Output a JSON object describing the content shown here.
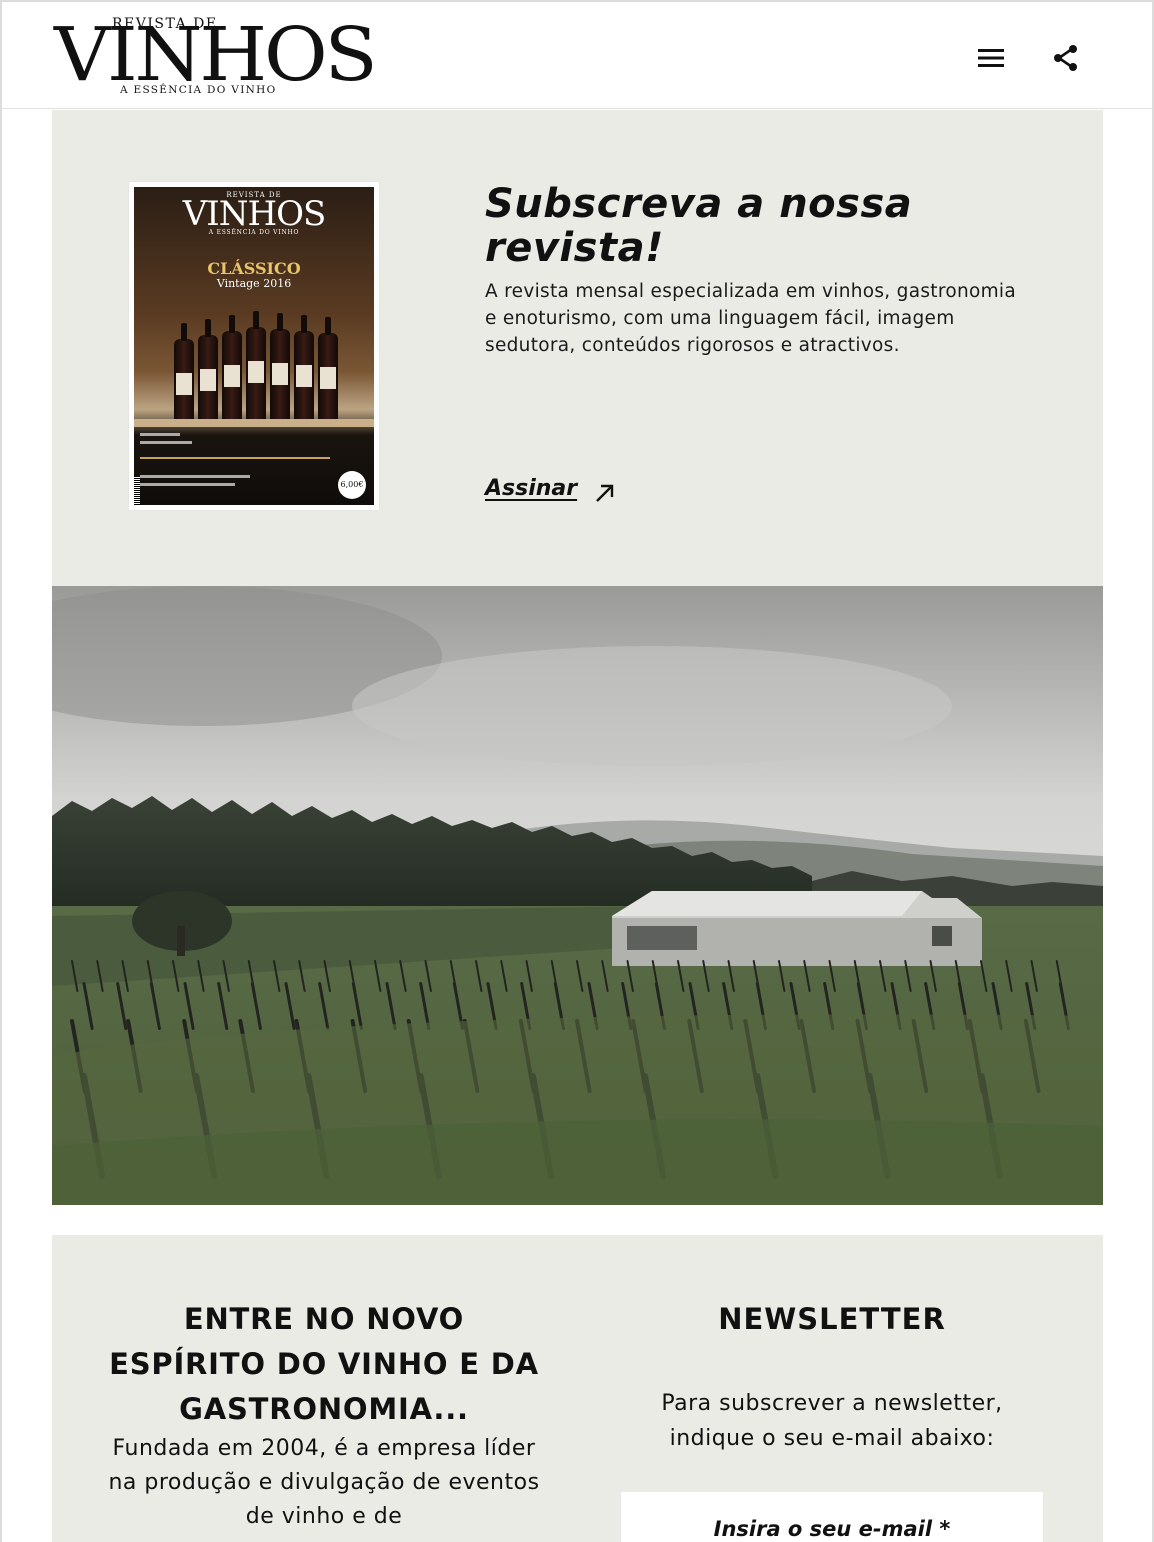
{
  "header": {
    "logo": {
      "top": "REVISTA DE",
      "main": "VINHOS",
      "bottom": "A ESSÊNCIA DO VINHO"
    },
    "icons": [
      "menu-icon",
      "share-icon"
    ]
  },
  "subscribe": {
    "title": "Subscreva a nossa revista!",
    "description": "A revista mensal especializada em vinhos, gastronomia e enoturismo, com uma linguagem fácil, imagem sedutora, conteúdos rigorosos e atractivos.",
    "link_label": "Assinar",
    "cover": {
      "logo_top": "REVISTA DE",
      "logo_main": "VINHOS",
      "logo_bottom": "A ESSÊNCIA DO VINHO",
      "headline": "CLÁSSICO",
      "subheadline": "Vintage 2016",
      "price": "6,00€"
    }
  },
  "about": {
    "heading": "ENTRE NO NOVO ESPÍRITO DO VINHO E DA GASTRONOMIA...",
    "text": "Fundada em 2004, é a empresa líder na produção e divulgação de eventos de vinho e de"
  },
  "newsletter": {
    "heading": "NEWSLETTER",
    "text": "Para subscrever a newsletter, indique o seu e-mail abaixo:",
    "email_placeholder": "Insira o seu e-mail *"
  },
  "colors": {
    "panel": "#ebebe6",
    "text": "#111111",
    "accent": "#e8c46a"
  }
}
